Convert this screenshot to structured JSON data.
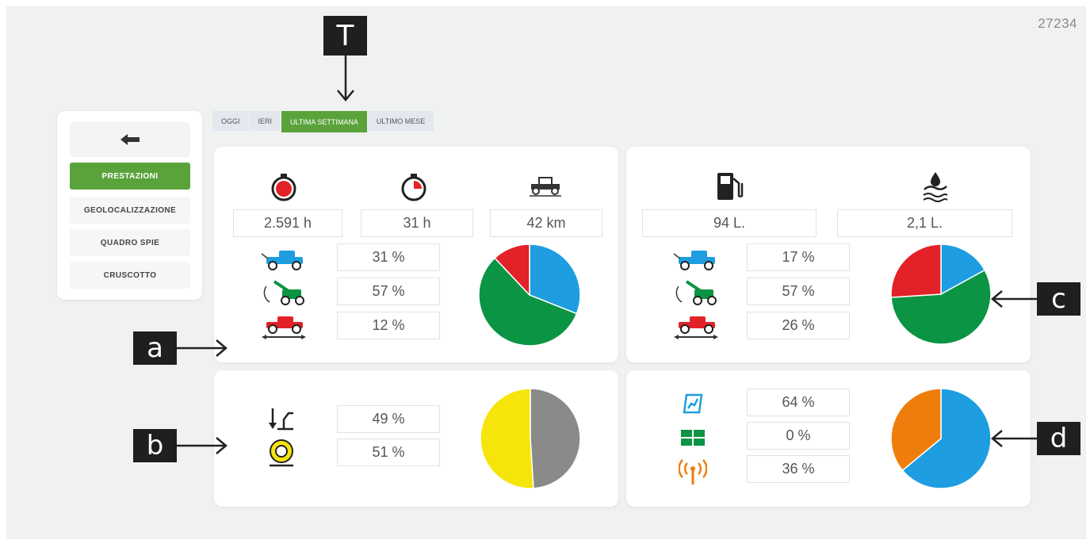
{
  "page_id": "27234",
  "sidebar": {
    "back_icon": "arrow-left-icon",
    "items": [
      {
        "label": "PRESTAZIONI",
        "active": true
      },
      {
        "label": "GEOLOCALIZZAZIONE",
        "active": false
      },
      {
        "label": "QUADRO SPIE",
        "active": false
      },
      {
        "label": "CRUSCOTTO",
        "active": false
      }
    ]
  },
  "tabs": [
    {
      "label": "OGGI",
      "active": false
    },
    {
      "label": "IERI",
      "active": false
    },
    {
      "label": "ULTIMA SETTIMANA",
      "active": true
    },
    {
      "label": "ULTIMO MESE",
      "active": false
    }
  ],
  "callouts": {
    "T": "T",
    "a": "a",
    "b": "b",
    "c": "c",
    "d": "d"
  },
  "performance": {
    "engine_hours": "2.591 h",
    "work_hours": "31 h",
    "distance": "42 km",
    "mode_percents": [
      "31 %",
      "57 %",
      "12 %"
    ]
  },
  "fuel": {
    "fuel_liters": "94 L.",
    "adblue_liters": "2,1 L.",
    "mode_percents": [
      "17 %",
      "57 %",
      "26 %"
    ]
  },
  "load": {
    "percents": [
      "49 %",
      "51 %"
    ]
  },
  "control": {
    "percents": [
      "64 %",
      "0 %",
      "36 %"
    ]
  },
  "colors": {
    "accent_green": "#5aa33a",
    "pie_blue": "#1e9ee0",
    "pie_green": "#0a9443",
    "pie_red": "#e32128",
    "pie_yellow": "#f5e50a",
    "pie_gray": "#8a8a8a",
    "pie_orange": "#ef7d0c"
  },
  "chart_data": [
    {
      "type": "pie",
      "categories": [
        "blue",
        "green",
        "red"
      ],
      "values": [
        31,
        57,
        12
      ]
    },
    {
      "type": "pie",
      "categories": [
        "blue",
        "green",
        "red"
      ],
      "values": [
        17,
        57,
        26
      ]
    },
    {
      "type": "pie",
      "categories": [
        "gray",
        "yellow"
      ],
      "values": [
        49,
        51
      ]
    },
    {
      "type": "pie",
      "categories": [
        "blue",
        "green",
        "orange"
      ],
      "values": [
        64,
        0,
        36
      ]
    }
  ]
}
